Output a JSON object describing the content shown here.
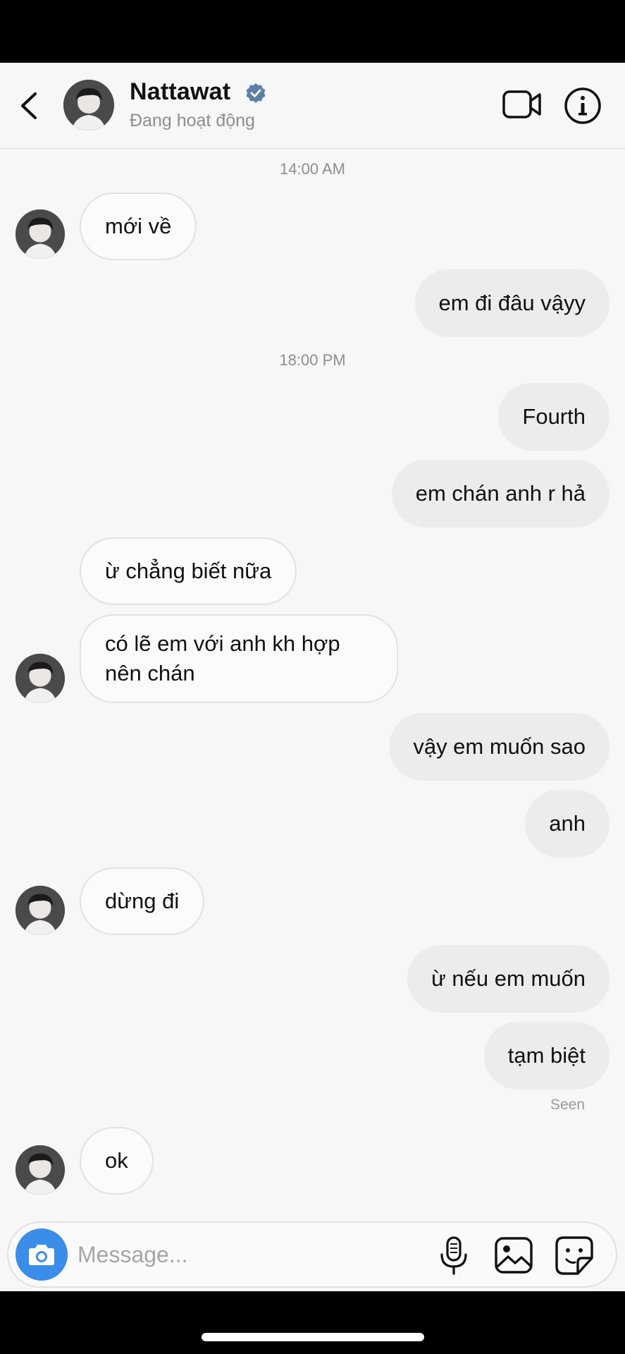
{
  "header": {
    "contact_name": "Nattawat",
    "contact_status": "Đang hoạt động"
  },
  "messages": {
    "ts1": "14:00 AM",
    "m1": "mới về",
    "m2": "em đi đâu vậyy",
    "ts2": "18:00 PM",
    "m3": "Fourth",
    "m4": "em chán anh r hả",
    "m5": "ừ chẳng biết nữa",
    "m6_line1": "có lẽ em với anh kh hợp",
    "m6_line2": "nên chán",
    "m7": "vậy em muốn sao",
    "m8": "anh",
    "m9": "dừng đi",
    "m10": "ừ nếu em muốn",
    "m11": "tạm biệt",
    "seen": "Seen",
    "m12": "ok"
  },
  "composer": {
    "placeholder": "Message...",
    "value": ""
  },
  "icons": {
    "back": "chevron-left-icon",
    "verified": "verified-badge-icon",
    "video": "video-camera-icon",
    "info": "info-icon",
    "camera": "camera-icon",
    "mic": "microphone-icon",
    "gallery": "image-icon",
    "sticker": "sticker-icon"
  },
  "colors": {
    "accent_blue": "#3a8de8",
    "verified_blue": "#5c7fa8",
    "incoming_bubble": "#fbfbfb",
    "outgoing_bubble": "#ececec",
    "background": "#f7f7f7"
  }
}
